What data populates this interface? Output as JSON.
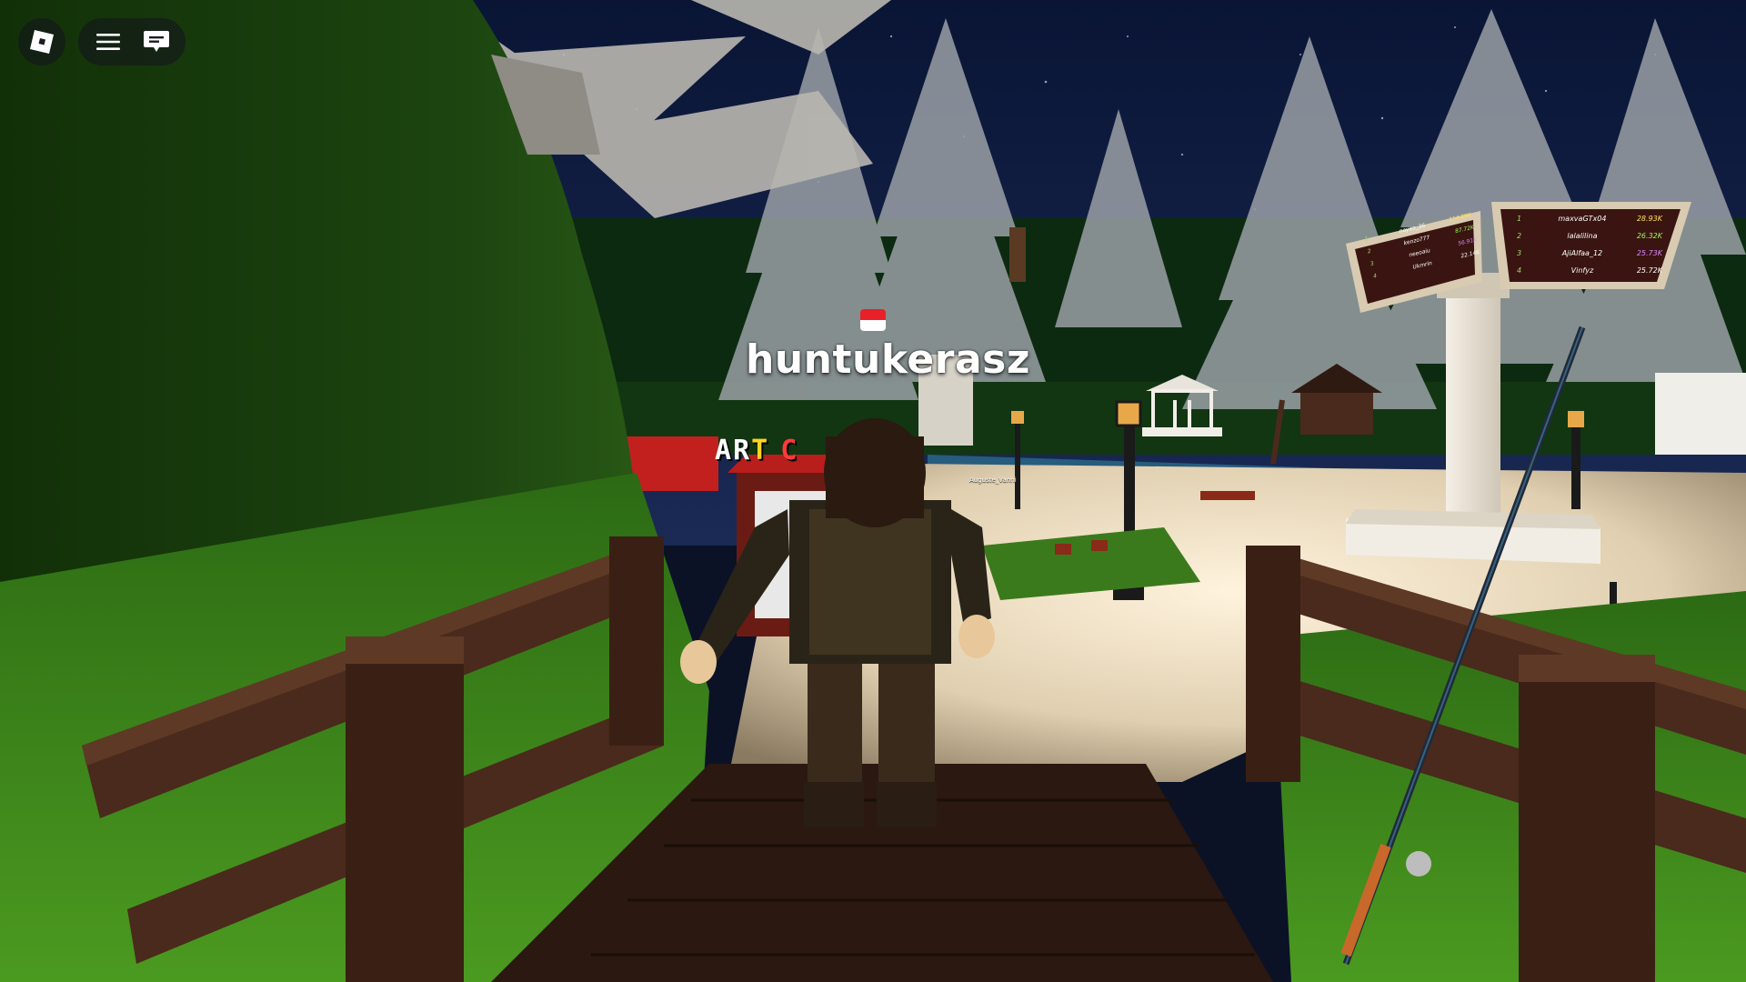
{
  "hud": {
    "roblox_menu_icon": "roblox-logo-icon",
    "menu_icon": "hamburger-menu-icon",
    "chat_icon": "chat-bubble-icon"
  },
  "player": {
    "name": "huntukerasz",
    "flag_colors": [
      "#e8202a",
      "#ffffff"
    ]
  },
  "world": {
    "shop_sign": {
      "letters": [
        "A",
        "R",
        "T",
        "C"
      ],
      "colors": [
        "#ffffff",
        "#ffffff",
        "#ffd21e",
        "#ff3a3a"
      ]
    },
    "nearby_label": "Auguste_Vanni",
    "leaderboard_right": {
      "rows": [
        {
          "rank": "1",
          "name": "maxvaGTx04",
          "value": "28.93K"
        },
        {
          "rank": "2",
          "name": "lalalilina",
          "value": "26.32K"
        },
        {
          "rank": "3",
          "name": "AjiAlfaa_12",
          "value": "25.73K"
        },
        {
          "rank": "4",
          "name": "Vinfyz",
          "value": "25.72K"
        }
      ]
    },
    "leaderboard_left": {
      "rows": [
        {
          "rank": "1",
          "name": "nayeo_36",
          "value": "114.29K"
        },
        {
          "rank": "2",
          "name": "kenzo777",
          "value": "87.72K"
        },
        {
          "rank": "3",
          "name": "neeoaiu",
          "value": "56.91K"
        },
        {
          "rank": "4",
          "name": "Ukmrin",
          "value": "22.14K"
        }
      ]
    }
  },
  "colors": {
    "sky": "#0d1a3d",
    "grass_dark": "#1f4a12",
    "grass_bright": "#3f8a1c",
    "wood": "#4a2a1c",
    "wood_dark": "#2b1810",
    "plaza": "#e9dcc4",
    "leaderboard_bg": "#3a1410",
    "leaderboard_frame": "#d8cbb2"
  }
}
